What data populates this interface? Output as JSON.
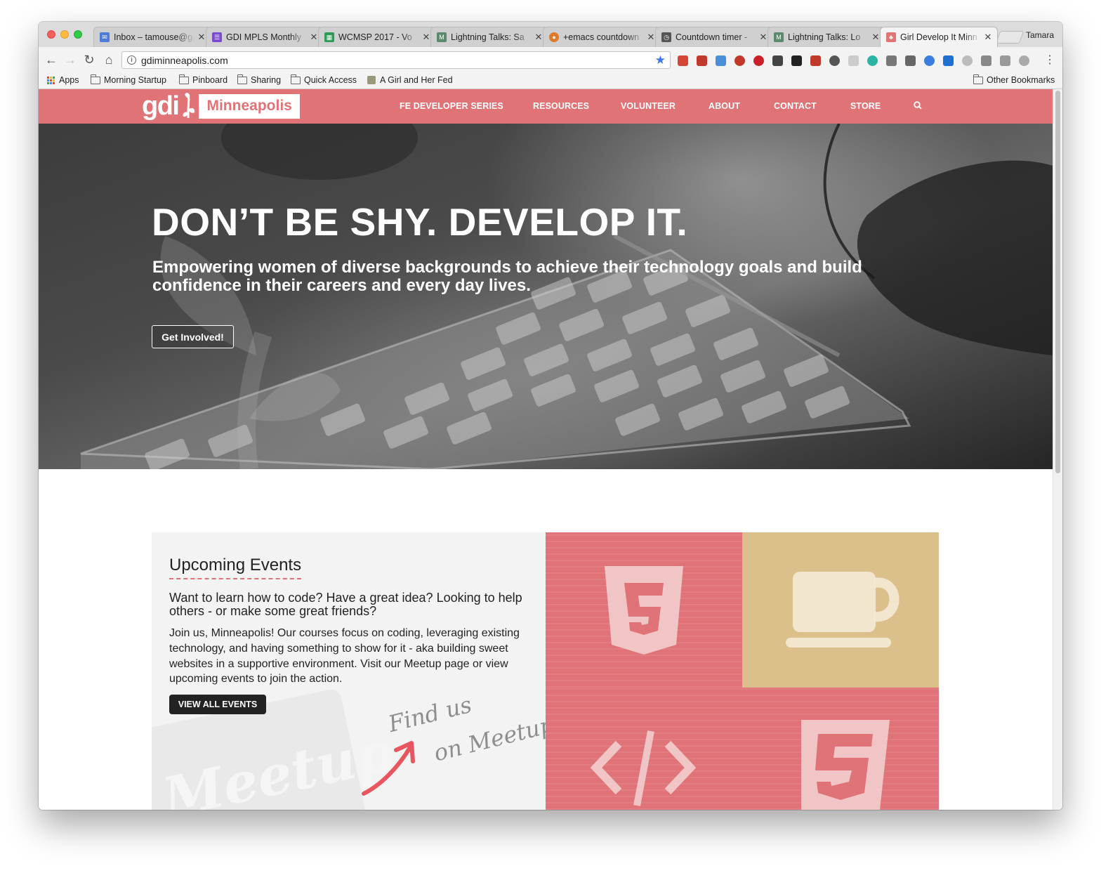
{
  "browser": {
    "tabs": [
      {
        "title": "Inbox – tamouse@gmail",
        "fav_color": "#4f7bd8"
      },
      {
        "title": "GDI MPLS Monthly",
        "fav_color": "#7b4bd0"
      },
      {
        "title": "WCMSP 2017 - Vo",
        "fav_color": "#2e9a55"
      },
      {
        "title": "Lightning Talks: Sa",
        "fav_color": "#5a8a6b"
      },
      {
        "title": "+emacs countdown",
        "fav_color": "#e07a2a"
      },
      {
        "title": "Countdown timer -",
        "fav_color": "#555555"
      },
      {
        "title": "Lightning Talks: Lo",
        "fav_color": "#5a8a6b"
      },
      {
        "title": "Girl Develop It Minn",
        "fav_color": "#e07376"
      }
    ],
    "profile_name": "Tamara",
    "url": "gdiminneapolis.com",
    "bookmarks": [
      "Apps",
      "Morning Startup",
      "Pinboard",
      "Sharing",
      "Quick Access",
      "A Girl and Her Fed"
    ],
    "other_bookmarks": "Other Bookmarks"
  },
  "site": {
    "logo_text": "gdi",
    "logo_city": "Minneapolis",
    "nav": [
      "FE DEVELOPER SERIES",
      "RESOURCES",
      "VOLUNTEER",
      "ABOUT",
      "CONTACT",
      "STORE"
    ],
    "brand_color": "#e07376"
  },
  "hero": {
    "headline": "DON’T BE SHY. DEVELOP IT.",
    "tagline": "Empowering women of diverse backgrounds to achieve their technology goals and build confidence in their careers and every day lives.",
    "cta_label": "Get Involved!"
  },
  "events": {
    "heading": "Upcoming Events",
    "lead": "Want to learn how to code? Have a great idea? Looking to help others - or make some great friends?",
    "body": "Join us, Minneapolis! Our courses focus on coding, leveraging existing technology, and having something to show for it - aka building sweet websites in a supportive environment. Visit our Meetup page or view upcoming events to join the action.",
    "button_label": "VIEW ALL EVENTS",
    "meetup_text_1": "Find us",
    "meetup_text_2": "on Meetup",
    "meetup_logo_text": "Meetup"
  },
  "tiles": [
    {
      "icon": "html5-icon",
      "color": "#e07378"
    },
    {
      "icon": "coffee-cup-icon",
      "color": "#dcc08c"
    },
    {
      "icon": "code-brackets-icon",
      "color": "#e07378"
    },
    {
      "icon": "css3-icon",
      "color": "#e07378"
    }
  ]
}
